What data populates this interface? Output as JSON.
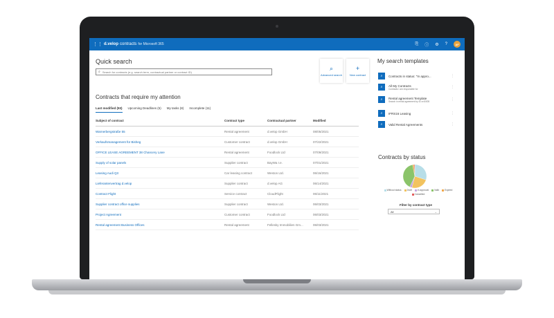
{
  "app": {
    "brand": "d.velop",
    "brand_product": "contracts",
    "brand_sub": "for Microsoft 365",
    "avatar_initials": "AF",
    "accent": "#0f6cbd"
  },
  "quick_search": {
    "title": "Quick search",
    "placeholder": "Search for contracts (e.g. search term, contractual partner or contract ID)"
  },
  "actions": {
    "advanced_search": "Advanced search",
    "new_contract": "New contract"
  },
  "attention": {
    "title": "Contracts that require my attention",
    "tabs": [
      "Last modified (93)",
      "Upcoming Deadlines (5)",
      "My tasks (8)",
      "Incomplete (11)"
    ],
    "columns": [
      "Subject of contract",
      "Contract type",
      "Contractual partner",
      "Modified"
    ],
    "rows": [
      {
        "subject": "Warnerbergstraße 55",
        "type": "Rental agreement",
        "partner": "d.velop GmbH",
        "modified": "08/05/2021"
      },
      {
        "subject": "Verkaufsmanagement für Bisheg",
        "type": "Customer contract",
        "partner": "d.velop GmbH",
        "modified": "07/22/2021"
      },
      {
        "subject": "OFFICE LEASE AGREEMENT 38 Chancery Lane",
        "type": "Rental agreement",
        "partner": "Foodlock Ltd",
        "modified": "07/09/2021"
      },
      {
        "subject": "Supply of solar panels",
        "type": "Supplier contract",
        "partner": "BayWa r.e.",
        "modified": "07/01/2021"
      },
      {
        "subject": "Leasing Audi Q3",
        "type": "Car leasing contract",
        "partner": "Weston Ltd.",
        "modified": "06/16/2021"
      },
      {
        "subject": "Lieferantenvertrag d.velop",
        "type": "Supplier contract",
        "partner": "d.velop AG",
        "modified": "06/14/2021"
      },
      {
        "subject": "Contract Flight",
        "type": "Service contract",
        "partner": "CloudFlight",
        "modified": "06/11/2021"
      },
      {
        "subject": "Supplier contract office supplies",
        "type": "Supplier contract",
        "partner": "Weston Ltd.",
        "modified": "06/03/2021"
      },
      {
        "subject": "Project Agreement",
        "type": "Customer contract",
        "partner": "Foodlock Ltd",
        "modified": "06/03/2021"
      },
      {
        "subject": "Rental agreement Business Offices",
        "type": "Rental agreement",
        "partner": "Fellesky Immobilien Gm...",
        "modified": "06/03/2021"
      }
    ]
  },
  "templates": {
    "title": "My search templates",
    "items": [
      {
        "name": "Contracts in status: \"In appro...",
        "desc": ""
      },
      {
        "name": "All My Contracts",
        "desc": "Contracts I am responsible for"
      },
      {
        "name": "Rental agreement Template",
        "desc": "Search in rental agreement by ID cr40005"
      },
      {
        "name": "IFRS16 Leasing",
        "desc": ""
      },
      {
        "name": "Valid Rental Agreements",
        "desc": ""
      }
    ]
  },
  "status": {
    "title": "Contracts by status",
    "legend": [
      {
        "label": "Without status",
        "color": "#b7dee8"
      },
      {
        "label": "Draft",
        "color": "#f2c35f"
      },
      {
        "label": "In approval",
        "color": "#c5a4e0"
      },
      {
        "label": "Valid",
        "color": "#8bc46a"
      },
      {
        "label": "Expired",
        "color": "#f0a84a"
      },
      {
        "label": "Cancelled",
        "color": "#e35d5d"
      }
    ],
    "chart_data": {
      "type": "pie",
      "categories": [
        "Without status",
        "Draft",
        "In approval",
        "Valid",
        "Expired",
        "Cancelled"
      ],
      "values": [
        30,
        24,
        3,
        40,
        2,
        1
      ]
    },
    "filter_label": "Filter by contract type",
    "filter_value": "All"
  }
}
